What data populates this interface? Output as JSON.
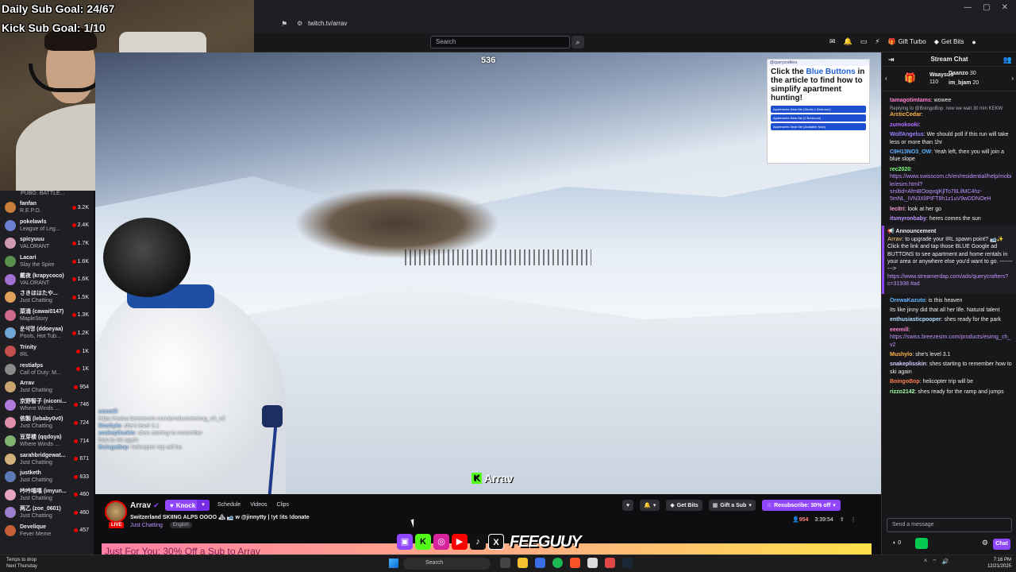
{
  "browser": {
    "url": "twitch.tv/arrav"
  },
  "overlay": {
    "daily_goal": "Daily Sub Goal: 24/67",
    "kick_goal": "Kick Sub Goal: 1/10",
    "viewer_overlay": "536",
    "kick_name": "Arrav",
    "kick_logo": "K",
    "feeguuy": "FEEGUUY",
    "overlay_chat": [
      {
        "user": "eeemill",
        "text": "https://swiss.breezesim.com/products/esimg_ch_v2"
      },
      {
        "user": "Mushylo",
        "text": "she's level 3.1"
      },
      {
        "user": "snakeplisskin",
        "text": "shes starting to remember how to ski again"
      },
      {
        "user": "BoingoBop",
        "text": "helicopter trip will be"
      }
    ]
  },
  "search": {
    "placeholder": "Search"
  },
  "nav": {
    "gift_turbo": "Gift Turbo",
    "get_bits": "Get Bits"
  },
  "sidebar": {
    "header": "PUBG: BATTLE...",
    "channels": [
      {
        "name": "fanfan",
        "game": "R.E.P.O.",
        "viewers": "3.2K",
        "color": "#c87d3a"
      },
      {
        "name": "pokelawls",
        "game": "League of Leg...",
        "viewers": "2.4K",
        "color": "#6b7fd1"
      },
      {
        "name": "spicyuuu",
        "game": "VALORANT",
        "viewers": "1.7K",
        "color": "#d19ab3"
      },
      {
        "name": "Lacari",
        "game": "Slay the Spire",
        "viewers": "1.6K",
        "color": "#5b8f4e"
      },
      {
        "name": "戴夜 (krapycoco)",
        "game": "VALORANT",
        "viewers": "1.6K",
        "color": "#a06fd0"
      },
      {
        "name": "さきほはたや...",
        "game": "Just Chatting",
        "viewers": "1.5K",
        "color": "#e0a05c"
      },
      {
        "name": "菜涌 (cawai0147)",
        "game": "MapleStory",
        "viewers": "1.3K",
        "color": "#ce6a8a"
      },
      {
        "name": "운석명 (ddoeyaa)",
        "game": "Pools, Hot Tub...",
        "viewers": "1.2K",
        "color": "#6fa6d4"
      },
      {
        "name": "Trinity",
        "game": "IRL",
        "viewers": "1K",
        "color": "#c44e4e"
      },
      {
        "name": "restiafps",
        "game": "Call of Duty: M...",
        "viewers": "1K",
        "color": "#8a8a8a"
      },
      {
        "name": "Arrav",
        "game": "Just Chatting",
        "viewers": "954",
        "color": "#caa46e"
      },
      {
        "name": "京野智子 (niconi...",
        "game": "Where Winds ...",
        "viewers": "746",
        "color": "#b07adf"
      },
      {
        "name": "依製 (lebaby0v0)",
        "game": "Just Chatting",
        "viewers": "724",
        "color": "#e08fa8"
      },
      {
        "name": "豆芽楼 (qqdoya)",
        "game": "Where Winds ...",
        "viewers": "714",
        "color": "#7fb36d"
      },
      {
        "name": "sarahbridgewat...",
        "game": "Just Chatting",
        "viewers": "671",
        "color": "#d4b07a"
      },
      {
        "name": "justketh",
        "game": "Just Chatting",
        "viewers": "633",
        "color": "#5d7ab5"
      },
      {
        "name": "吟吟嘻嘻 (imyun...",
        "game": "Just Chatting",
        "viewers": "460",
        "color": "#e6a5c0"
      },
      {
        "name": "两乙 (zoe_0601)",
        "game": "Just Chatting",
        "viewers": "460",
        "color": "#9f7fcf"
      },
      {
        "name": "Develique",
        "game": "Fever Meme",
        "viewers": "457",
        "color": "#c45f3a"
      }
    ]
  },
  "ad": {
    "brand": "@querycrafters",
    "headline_1": "Click the ",
    "headline_blue": "Blue Buttons",
    "headline_2": " in the article to find how to simplify apartment hunting!",
    "buttons": [
      "Apartments Near Me (Studio 1 Bedroom)",
      "Apartments Near Me (2 Bedroom)",
      "Apartments Near Me (Available Now)"
    ]
  },
  "channel": {
    "name": "Arrav",
    "live": "LIVE",
    "knock": "Knock",
    "tabs": [
      "Schedule",
      "Videos",
      "Clips"
    ],
    "title": "Switzerland SKIING ALPS OOOO 🏔 🎿 w @jinnytty | !yt !its !donate",
    "category": "Just Chatting",
    "language": "English",
    "get_bits": "Get Bits",
    "gift_a_sub": "Gift a Sub",
    "resubscribe": "Resubscribe: 30% off",
    "viewers": "954",
    "uptime": "3:39:54"
  },
  "promo": {
    "text": "Just For You: 30% Off a Sub to Arrav"
  },
  "chat": {
    "header": "Stream Chat",
    "leaderboard": [
      {
        "name": "Waaysus",
        "value": "110"
      },
      {
        "name": "Daanzo",
        "value": "30"
      },
      {
        "name": "im_bjam",
        "value": "20"
      }
    ],
    "messages": [
      {
        "user": "tamagotimtams",
        "color": "#ff7fd0",
        "text": "wowee"
      },
      {
        "reply": "Replying to @BoingoBop: now we wait 30 min KEKW"
      },
      {
        "user": "ArcticCedar",
        "color": "#ffb347",
        "text": ""
      },
      {
        "user": "zumokooki",
        "color": "#b06dff",
        "text": ""
      },
      {
        "user": "WolfAngelus",
        "color": "#9f7fff",
        "text": "We should poll if this run will take less or more than 1hr"
      },
      {
        "user": "C9H13NO3_OW",
        "color": "#5fb4ff",
        "text": "Yeah left, then you will join a blue slope"
      },
      {
        "user": "rec2020",
        "color": "#7cff7c",
        "text": "https://www.swisscom.ch/en/residential/help/mobile/esim.html?srsltid=AfmBOoqvqjKjlTo78LilMC4hz-5mNL_IVN3XlIPIFT8h1z1uV9wDDNOeH",
        "link": true
      },
      {
        "user": "lecitri",
        "color": "#ff9bd6",
        "text": "look at her go"
      },
      {
        "user": "itsmyronbaby",
        "color": "#bf94ff",
        "text": "heres comes the sun"
      }
    ],
    "announcement_title": "Announcement",
    "announcement": {
      "user": "Arrav",
      "color": "#caa46e",
      "text": "to upgrade your IRL spawn point? 🎿✨ Click the link and tap those BLUE Google ad BUTTONS to see apartment and home rentals in your area or anywhere else you'd want to go. ----------> ",
      "link": "https://www.streamerdap.com/ads/querycrafters?c=31938 #ad"
    },
    "messages_2": [
      {
        "user": "OrewaKazuto",
        "color": "#5fb4ff",
        "text": "is this heaven"
      },
      {
        "user": "",
        "color": "#ff4f4f",
        "text": "Its like jinny did that all her life. Natural talent"
      },
      {
        "user": "enthusiasticpooper",
        "color": "#b0e0ff",
        "text": "shes ready for the park"
      },
      {
        "user": "eeemill",
        "color": "#ff7fd0",
        "text": "https://swiss.breezesim.com/products/esimg_ch_v2",
        "link": true
      },
      {
        "user": "Mushylo",
        "color": "#ffb347",
        "text": "she's level 3.1"
      },
      {
        "user": "snakeplisskin",
        "color": "#d0d0ff",
        "text": "shes starting to remember how to ski again"
      },
      {
        "user": "BoingoBop",
        "color": "#ff7f50",
        "text": "helicopter trip will be"
      },
      {
        "user": "rizzo2142",
        "color": "#9fff9f",
        "text": "shes ready for the ramp and jumps"
      }
    ],
    "input_placeholder": "Send a message",
    "points": "0",
    "chat_button": "Chat"
  },
  "taskbar": {
    "weather_1": "Temps to drop",
    "weather_2": "Next Thursday",
    "search": "Search",
    "time": "7:16 PM",
    "date": "12/21/2025"
  }
}
